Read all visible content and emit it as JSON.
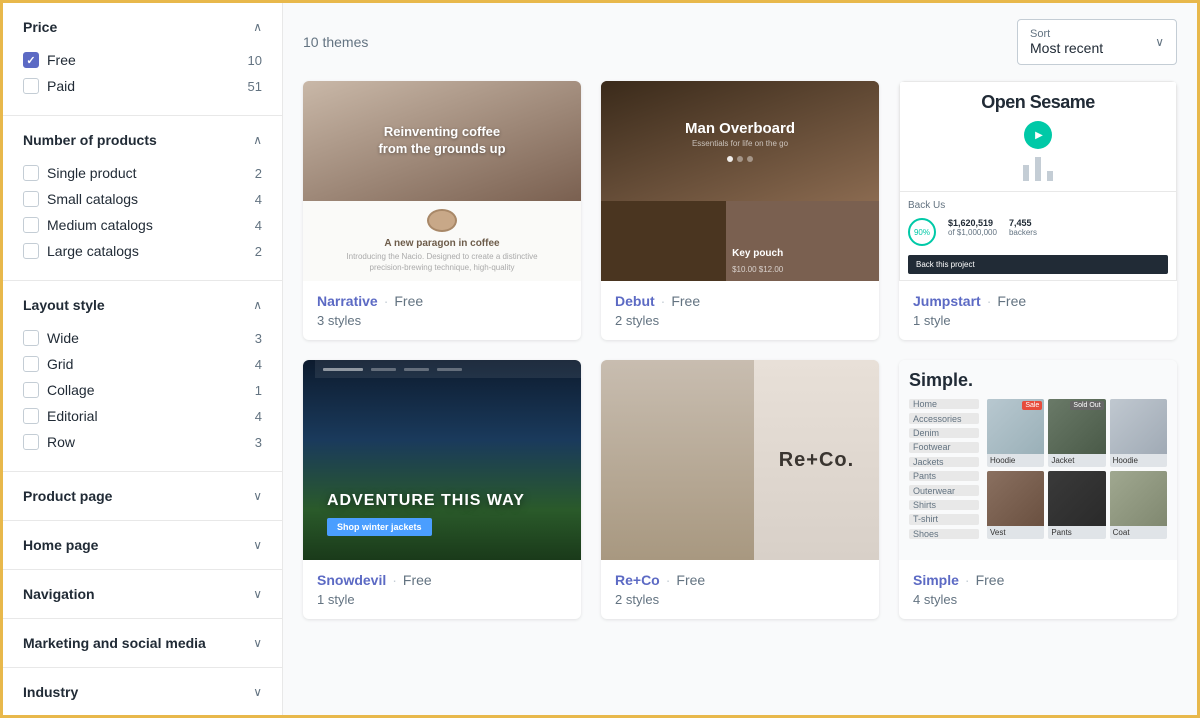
{
  "sidebar": {
    "sections": [
      {
        "id": "price",
        "title": "Price",
        "expanded": true,
        "items": [
          {
            "label": "Free",
            "count": 10,
            "checked": true
          },
          {
            "label": "Paid",
            "count": 51,
            "checked": false
          }
        ]
      },
      {
        "id": "number_of_products",
        "title": "Number of products",
        "expanded": true,
        "items": [
          {
            "label": "Single product",
            "count": 2,
            "checked": false
          },
          {
            "label": "Small catalogs",
            "count": 4,
            "checked": false
          },
          {
            "label": "Medium catalogs",
            "count": 4,
            "checked": false
          },
          {
            "label": "Large catalogs",
            "count": 2,
            "checked": false
          }
        ]
      },
      {
        "id": "layout_style",
        "title": "Layout style",
        "expanded": true,
        "items": [
          {
            "label": "Wide",
            "count": 3,
            "checked": false
          },
          {
            "label": "Grid",
            "count": 4,
            "checked": false
          },
          {
            "label": "Collage",
            "count": 1,
            "checked": false
          },
          {
            "label": "Editorial",
            "count": 4,
            "checked": false
          },
          {
            "label": "Row",
            "count": 3,
            "checked": false
          }
        ]
      },
      {
        "id": "product_page",
        "title": "Product page",
        "expanded": false,
        "items": []
      },
      {
        "id": "home_page",
        "title": "Home page",
        "expanded": false,
        "items": []
      },
      {
        "id": "navigation",
        "title": "Navigation",
        "expanded": false,
        "items": []
      },
      {
        "id": "marketing_social_media",
        "title": "Marketing and social media",
        "expanded": false,
        "items": []
      },
      {
        "id": "industry",
        "title": "Industry",
        "expanded": false,
        "items": []
      }
    ]
  },
  "main": {
    "themes_count": "10 themes",
    "sort": {
      "label": "Sort",
      "value": "Most recent"
    },
    "themes": [
      {
        "id": "narrative",
        "name": "Narrative",
        "price": "Free",
        "styles": "3 styles",
        "preview_type": "narrative"
      },
      {
        "id": "debut",
        "name": "Debut",
        "price": "Free",
        "styles": "2 styles",
        "preview_type": "debut"
      },
      {
        "id": "jumpstart",
        "name": "Jumpstart",
        "price": "Free",
        "styles": "1 style",
        "preview_type": "jumpstart"
      },
      {
        "id": "snowdevil",
        "name": "Snowdevil",
        "price": "Free",
        "styles": "1 style",
        "preview_type": "snowdevil"
      },
      {
        "id": "reco",
        "name": "Re+Co",
        "price": "Free",
        "styles": "2 styles",
        "preview_type": "reco"
      },
      {
        "id": "simple",
        "name": "Simple",
        "price": "Free",
        "styles": "4 styles",
        "preview_type": "simple"
      }
    ]
  },
  "icons": {
    "chevron_up": "∧",
    "chevron_down": "∨",
    "play": "▶"
  }
}
